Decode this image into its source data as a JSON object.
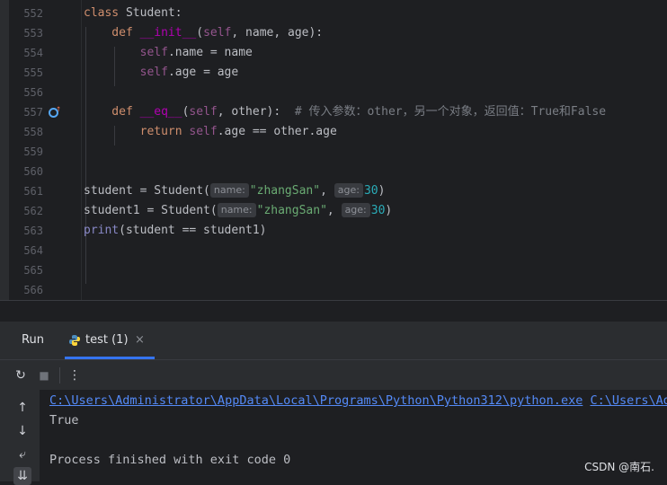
{
  "editor": {
    "lines": [
      {
        "num": "552",
        "tokens": [
          {
            "t": "class ",
            "c": "kw"
          },
          {
            "t": "Student:",
            "c": ""
          }
        ]
      },
      {
        "num": "553",
        "tokens": [
          {
            "t": "    def ",
            "c": "kw"
          },
          {
            "t": "__init__",
            "c": "dunder"
          },
          {
            "t": "(",
            "c": ""
          },
          {
            "t": "self",
            "c": "self"
          },
          {
            "t": ", name, age):",
            "c": ""
          }
        ]
      },
      {
        "num": "554",
        "tokens": [
          {
            "t": "        ",
            "c": ""
          },
          {
            "t": "self",
            "c": "self"
          },
          {
            "t": ".name = name",
            "c": ""
          }
        ]
      },
      {
        "num": "555",
        "tokens": [
          {
            "t": "        ",
            "c": ""
          },
          {
            "t": "self",
            "c": "self"
          },
          {
            "t": ".age = age",
            "c": ""
          }
        ]
      },
      {
        "num": "556",
        "tokens": []
      },
      {
        "num": "557",
        "icon": "override-method-icon",
        "tokens": [
          {
            "t": "    def ",
            "c": "kw"
          },
          {
            "t": "__eq__",
            "c": "dunder"
          },
          {
            "t": "(",
            "c": ""
          },
          {
            "t": "self",
            "c": "self"
          },
          {
            "t": ", other):  ",
            "c": ""
          },
          {
            "t": "# 传入参数：other，另一个对象，返回值：True和False",
            "c": "cmt"
          }
        ]
      },
      {
        "num": "558",
        "tokens": [
          {
            "t": "        return ",
            "c": "kw"
          },
          {
            "t": "self",
            "c": "self"
          },
          {
            "t": ".age == other.age",
            "c": ""
          }
        ]
      },
      {
        "num": "559",
        "tokens": []
      },
      {
        "num": "560",
        "tokens": []
      },
      {
        "num": "561",
        "tokens": [
          {
            "t": "student = Student(",
            "c": ""
          },
          {
            "t": "name:",
            "c": "hint"
          },
          {
            "t": "\"zhangSan\"",
            "c": "str"
          },
          {
            "t": ", ",
            "c": ""
          },
          {
            "t": "age:",
            "c": "hint"
          },
          {
            "t": "30",
            "c": "num"
          },
          {
            "t": ")",
            "c": ""
          }
        ]
      },
      {
        "num": "562",
        "tokens": [
          {
            "t": "student1 = Student(",
            "c": ""
          },
          {
            "t": "name:",
            "c": "hint"
          },
          {
            "t": "\"zhangSan\"",
            "c": "str"
          },
          {
            "t": ", ",
            "c": ""
          },
          {
            "t": "age:",
            "c": "hint"
          },
          {
            "t": "30",
            "c": "num"
          },
          {
            "t": ")",
            "c": ""
          }
        ]
      },
      {
        "num": "563",
        "tokens": [
          {
            "t": "print",
            "c": "builtin"
          },
          {
            "t": "(student == student1)",
            "c": ""
          }
        ]
      },
      {
        "num": "564",
        "tokens": []
      },
      {
        "num": "565",
        "tokens": []
      },
      {
        "num": "566",
        "tokens": []
      }
    ]
  },
  "run_panel": {
    "title": "Run",
    "tab_label": "test (1)",
    "tab_close": "×",
    "toolbar": {
      "rerun": "↻",
      "stop": "■",
      "more": "⋮"
    },
    "side": {
      "up": "↑",
      "down": "↓",
      "wrap": "⤶",
      "scroll_end": "⇊"
    },
    "console": {
      "cmd_path": "C:\\Users\\Administrator\\AppData\\Local\\Programs\\Python\\Python312\\python.exe",
      "cmd_arg": "C:\\Users\\Adm",
      "output": "True",
      "exit_message": "Process finished with exit code 0"
    }
  },
  "watermark": "CSDN @南石.",
  "colors": {
    "accent": "#3574f0",
    "link": "#548af7",
    "keyword": "#cf8e6d",
    "string": "#6aab73",
    "number": "#2aacb8"
  }
}
